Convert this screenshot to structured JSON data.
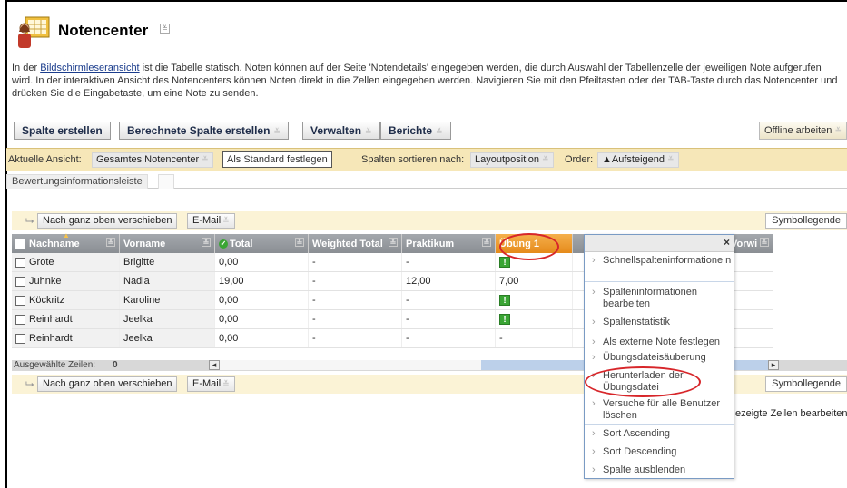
{
  "page": {
    "title": "Notencenter",
    "intro_prefix": "In der ",
    "intro_link": "Bildschirmleseransicht",
    "intro_rest": " ist die Tabelle statisch. Noten können auf der Seite 'Notendetails' eingegeben werden, die durch Auswahl der Tabellenzelle der jeweiligen Note aufgerufen wird. In der interaktiven Ansicht des Notencenters können Noten direkt in die Zellen eingegeben werden. Navigieren Sie mit den Pfeiltasten oder der TAB-Taste durch das Notencenter und drücken Sie die Eingabetaste, um eine Note zu senden."
  },
  "toolbar": {
    "create_column": "Spalte erstellen",
    "calc_column": "Berechnete Spalte erstellen",
    "manage": "Verwalten",
    "reports": "Berichte",
    "offline": "Offline arbeiten"
  },
  "viewbar": {
    "current_view_label": "Aktuelle Ansicht:",
    "current_view_value": "Gesamtes Notencenter",
    "set_default": "Als Standard festlegen",
    "sort_label": "Spalten sortieren nach:",
    "sort_value": "Layoutposition",
    "order_label": "Order:",
    "order_value": "▲Aufsteigend"
  },
  "tabs": {
    "assessment_bar": "Bewertungsinformationsleiste"
  },
  "actions": {
    "move_top": "Nach ganz oben verschieben",
    "email": "E-Mail",
    "legend": "Symbollegende"
  },
  "table": {
    "columns": [
      "Nachname",
      "Vorname",
      "Total",
      "Weighted Total",
      "Praktikum",
      "Übung 1",
      "",
      "Vorwi"
    ],
    "rows": [
      {
        "last": "Grote",
        "first": "Brigitte",
        "total": "0,00",
        "weighted": "-",
        "praktikum": "-",
        "uebung": "!"
      },
      {
        "last": "Juhnke",
        "first": "Nadia",
        "total": "19,00",
        "weighted": "-",
        "praktikum": "12,00",
        "uebung": "7,00"
      },
      {
        "last": "Köckritz",
        "first": "Karoline",
        "total": "0,00",
        "weighted": "-",
        "praktikum": "-",
        "uebung": "!"
      },
      {
        "last": "Reinhardt",
        "first": "Jeelka",
        "total": "0,00",
        "weighted": "-",
        "praktikum": "-",
        "uebung": "!"
      },
      {
        "last": "Reinhardt",
        "first": "Jeelka",
        "total": "0,00",
        "weighted": "-",
        "praktikum": "-",
        "uebung": "-"
      }
    ],
    "selected_rows_label": "Ausgewählte Zeilen:",
    "selected_rows_count": "0"
  },
  "context_menu": {
    "close": "×",
    "items": [
      "Schnellspalteninformatione n",
      "Spalteninformationen bearbeiten",
      "Spaltenstatistik",
      "Als externe Note festlegen",
      "Übungsdateisäuberung",
      "Herunterladen der Übungsdatei",
      "Versuche für alle Benutzer löschen",
      "Sort Ascending",
      "Sort Descending",
      "Spalte ausblenden"
    ]
  },
  "right_text": "ezeigte Zeilen bearbeiten",
  "colors": {
    "accent_red": "#d7262a",
    "header_gray": "#8a8e93",
    "view_bar": "#f6e7b8",
    "green_icon": "#3aa534"
  }
}
